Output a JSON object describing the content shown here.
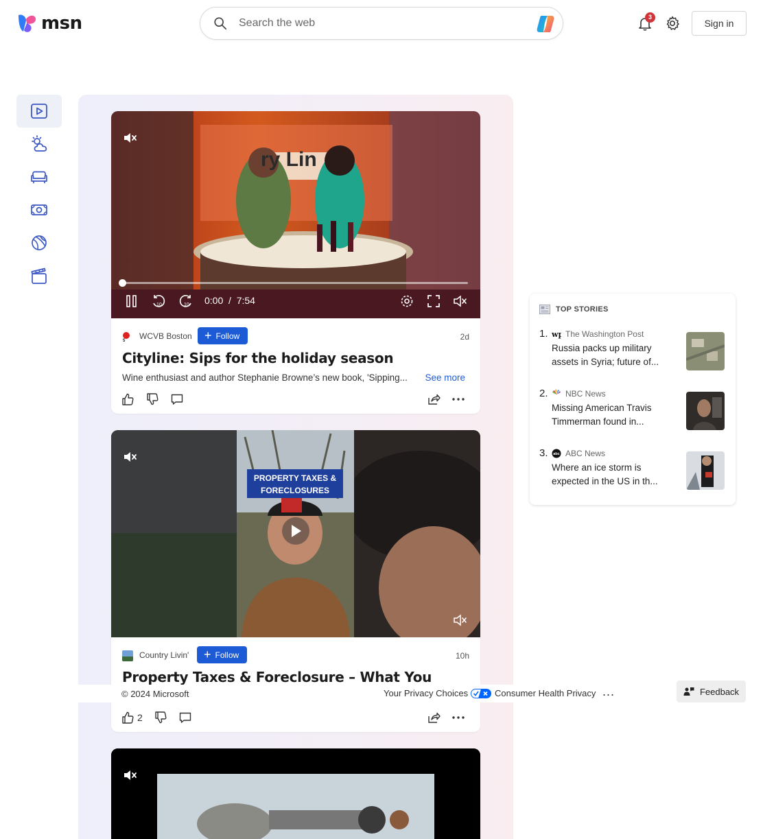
{
  "header": {
    "logo_text": "msn",
    "search_placeholder": "Search the web",
    "notification_count": "3",
    "sign_in_label": "Sign in"
  },
  "rail": {
    "items": [
      {
        "icon": "video-icon",
        "active": true
      },
      {
        "icon": "weather-icon",
        "active": false
      },
      {
        "icon": "home-couch-icon",
        "active": false
      },
      {
        "icon": "money-icon",
        "active": false
      },
      {
        "icon": "sports-ball-icon",
        "active": false
      },
      {
        "icon": "clapperboard-icon",
        "active": false
      }
    ]
  },
  "feed": {
    "cards": [
      {
        "source": "WCVB Boston",
        "follow_label": "Follow",
        "age": "2d",
        "title": "Cityline: Sips for the holiday season",
        "description": "Wine enthusiast and author Stephanie Browne’s new book, 'Sipping...",
        "see_more": "See more",
        "time_current": "0:00",
        "time_separator": "/",
        "time_total": "7:54",
        "video_overlay_text": "ry Lin"
      },
      {
        "source": "Country Livin'",
        "follow_label": "Follow",
        "age": "10h",
        "title": "Property Taxes & Foreclosure – What You Should Know!",
        "video_overlay_line1": "PROPERTY TAXES &",
        "video_overlay_line2": "FORECLOSURES",
        "like_count": "2"
      }
    ]
  },
  "top_stories": {
    "heading": "TOP STORIES",
    "items": [
      {
        "num": "1.",
        "source": "The Washington Post",
        "title": "Russia packs up military assets in Syria; future of..."
      },
      {
        "num": "2.",
        "source": "NBC News",
        "title": "Missing American Travis Timmerman found in..."
      },
      {
        "num": "3.",
        "source": "ABC News",
        "title": "Where an ice storm is expected in the US in th..."
      }
    ]
  },
  "footer": {
    "copyright": "© 2024 Microsoft",
    "privacy_choices": "Your Privacy Choices",
    "health_privacy": "Consumer Health Privacy",
    "more": "...",
    "feedback_label": "Feedback"
  },
  "colors": {
    "accent": "#1d5bd6",
    "badge": "#d13438",
    "rail_icon": "#3b57c4"
  }
}
